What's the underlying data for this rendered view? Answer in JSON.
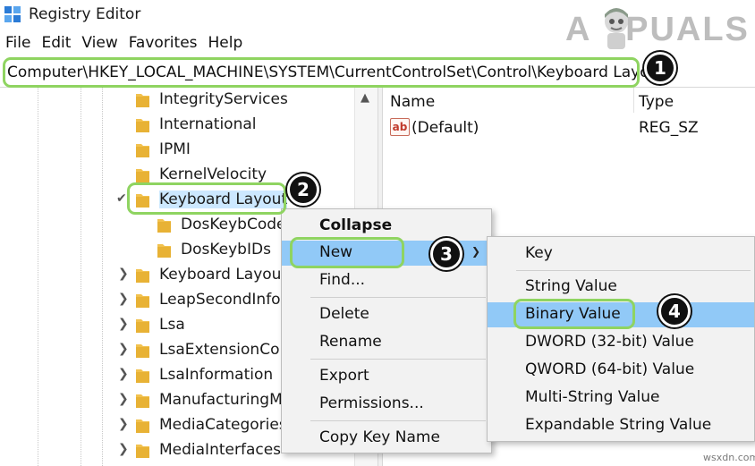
{
  "window": {
    "title": "Registry Editor"
  },
  "watermark": {
    "text": "APPUALS",
    "site": "wsxdn.com"
  },
  "menubar": [
    {
      "label": "File"
    },
    {
      "label": "Edit"
    },
    {
      "label": "View"
    },
    {
      "label": "Favorites"
    },
    {
      "label": "Help"
    }
  ],
  "address": {
    "path": "Computer\\HKEY_LOCAL_MACHINE\\SYSTEM\\CurrentControlSet\\Control\\Keyboard Layout"
  },
  "tree": {
    "items": [
      {
        "label": "IntegrityServices",
        "expander": ""
      },
      {
        "label": "International",
        "expander": ""
      },
      {
        "label": "IPMI",
        "expander": ""
      },
      {
        "label": "KernelVelocity",
        "expander": ""
      },
      {
        "label": "Keyboard Layout",
        "expander": "expanded"
      },
      {
        "label": "DosKeybCodes",
        "expander": ""
      },
      {
        "label": "DosKeybIDs",
        "expander": ""
      },
      {
        "label": "Keyboard Layouts",
        "expander": "collapsed"
      },
      {
        "label": "LeapSecondInformation",
        "expander": "collapsed"
      },
      {
        "label": "Lsa",
        "expander": "collapsed"
      },
      {
        "label": "LsaExtensionConfig",
        "expander": "collapsed"
      },
      {
        "label": "LsaInformation",
        "expander": "collapsed"
      },
      {
        "label": "ManufacturingMode",
        "expander": "collapsed"
      },
      {
        "label": "MediaCategories",
        "expander": "collapsed"
      },
      {
        "label": "MediaInterfaces",
        "expander": "collapsed"
      }
    ]
  },
  "values_pane": {
    "headers": {
      "name": "Name",
      "type": "Type"
    },
    "rows": [
      {
        "icon": "ab",
        "name": "(Default)",
        "type": "REG_SZ"
      }
    ]
  },
  "context_menu": {
    "items": [
      "Collapse",
      "New",
      "Find...",
      "Delete",
      "Rename",
      "Export",
      "Permissions...",
      "Copy Key Name"
    ]
  },
  "new_submenu": {
    "items": [
      "Key",
      "String Value",
      "Binary Value",
      "DWORD (32-bit) Value",
      "QWORD (64-bit) Value",
      "Multi-String Value",
      "Expandable String Value"
    ]
  },
  "badges": [
    "1",
    "2",
    "3",
    "4"
  ],
  "colors": {
    "highlight": "#8fd461",
    "menu_active": "#91c9f7",
    "folder": "#f2c24f"
  }
}
